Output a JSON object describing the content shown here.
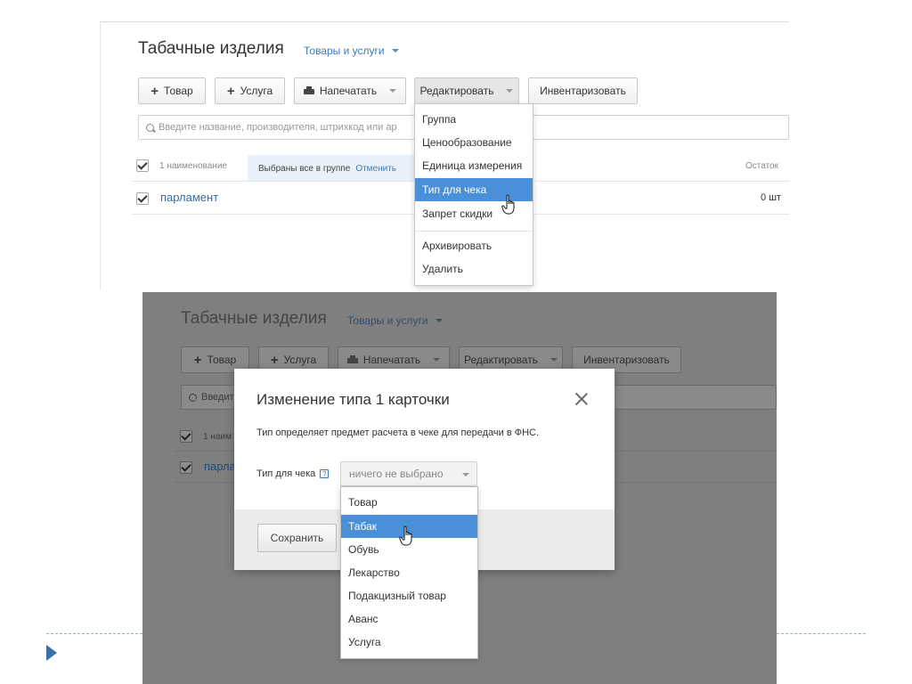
{
  "top": {
    "title": "Табачные изделия",
    "subtitle": "Товары и услуги",
    "toolbar": {
      "add_product": "Товар",
      "add_service": "Услуга",
      "print": "Напечатать",
      "edit": "Редактировать",
      "inventory": "Инвентаризовать"
    },
    "search_placeholder": "Введите название, производителя, штрихкод или ар",
    "list_header": {
      "count": "1 наименование",
      "selected_text": "Выбраны все в группе",
      "cancel": "Отменить",
      "stock_col": "Остаток"
    },
    "row": {
      "name": "парламент",
      "stock": "0 шт"
    },
    "edit_menu": {
      "items": [
        "Группа",
        "Ценообразование",
        "Единица измерения",
        "Тип для чека",
        "Запрет скидки"
      ],
      "active_index": 3,
      "items2": [
        "Архивировать",
        "Удалить"
      ]
    }
  },
  "bottom": {
    "bg": {
      "title": "Табачные изделия",
      "subtitle": "Товары и услуги",
      "add_product": "Товар",
      "add_service": "Услуга",
      "print": "Напечатать",
      "edit": "Редактировать",
      "inventory": "Инвентаризовать",
      "search_partial": "Введит",
      "count_partial": "1 наим",
      "row_partial": "парла"
    },
    "modal": {
      "title": "Изменение типа 1 карточки",
      "description": "Тип определяет предмет расчета в чеке для передачи в ФНС.",
      "field_label": "Тип для чека",
      "help": "?",
      "select_value": "ничего не выбрано",
      "save": "Сохранить"
    },
    "type_options": [
      "Товар",
      "Табак",
      "Обувь",
      "Лекарство",
      "Подакцизный товар",
      "Аванс",
      "Услуга"
    ],
    "active_option_index": 1
  }
}
